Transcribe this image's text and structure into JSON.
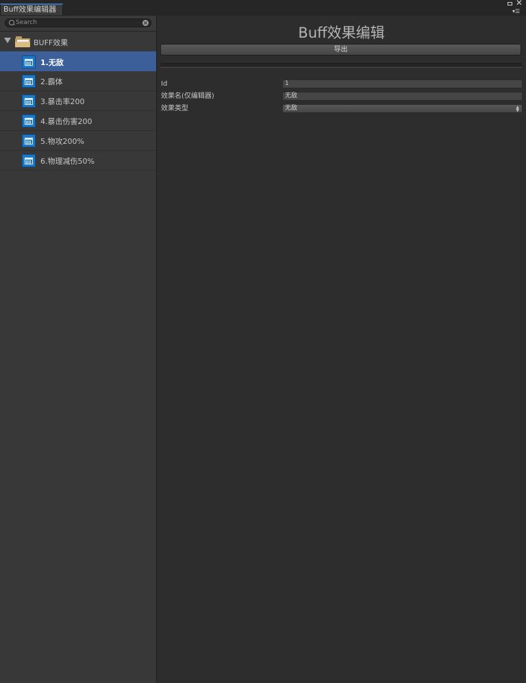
{
  "window": {
    "tab_title": "Buff效果编辑器"
  },
  "search": {
    "placeholder": "Search",
    "value": ""
  },
  "tree": {
    "root_label": "BUFF效果",
    "items": [
      {
        "label": "1.无敌"
      },
      {
        "label": "2.霸体"
      },
      {
        "label": "3.暴击率200"
      },
      {
        "label": "4.暴击伤害200"
      },
      {
        "label": "5.物攻200%"
      },
      {
        "label": "6.物理减伤50%"
      }
    ],
    "selected_index": 0
  },
  "editor": {
    "title": "Buff效果编辑",
    "export_label": "导出",
    "fields": [
      {
        "label": "Id",
        "value": "1",
        "type": "text"
      },
      {
        "label": "效果名(仅编辑器)",
        "value": "无敌",
        "type": "text"
      },
      {
        "label": "效果类型",
        "value": "无敌",
        "type": "select"
      }
    ]
  },
  "colors": {
    "selection": "#3d5f99",
    "tab_accent": "#3b6fb2",
    "item_icon": "#1c79c9",
    "folder": "#d9bc7f"
  },
  "icons": {
    "root": "folder-icon",
    "item": "buff-effect-icon",
    "expand": "triangle-down-icon",
    "search": "search-icon",
    "clear": "clear-icon"
  }
}
